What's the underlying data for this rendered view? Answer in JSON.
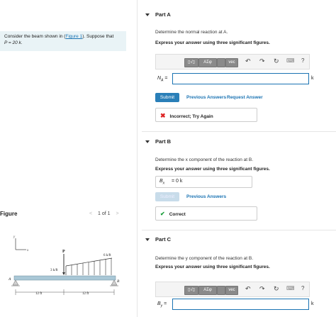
{
  "left": {
    "intro_prefix": "Consider the beam shown in (",
    "intro_link": "Figure 1",
    "intro_suffix": "). Suppose that",
    "intro_line2": "P = 20 k.",
    "figure_title": "Figure",
    "pager": "1 of 1",
    "prev_icon": "chevron-left-icon",
    "next_icon": "chevron-right-icon",
    "diagram": {
      "axis_y": "y",
      "axis_x": "x",
      "load_P": "P",
      "load_left": "3 k/ft",
      "load_right": "6 k/ft",
      "label_A": "A",
      "label_B": "B",
      "dim_left": "12 ft",
      "dim_right": "12 ft"
    }
  },
  "partA": {
    "title": "Part A",
    "question": "Determine the normal reaction at A.",
    "instruction": "Express your answer using three significant figures.",
    "label": "N",
    "sub": "A",
    "equals": "=",
    "unit": "k",
    "input_value": "",
    "submit": "Submit",
    "prev_answers": "Previous Answers",
    "request_answer": "Request Answer",
    "feedback": "Incorrect; Try Again"
  },
  "partB": {
    "title": "Part B",
    "question": "Determine the x component of the reaction at B.",
    "instruction": "Express your answer using three significant figures.",
    "label": "B",
    "sub": "x",
    "value_text": "= 0  k",
    "submit": "Submit",
    "prev_answers": "Previous Answers",
    "feedback": "Correct"
  },
  "partC": {
    "title": "Part C",
    "question": "Determine the y component of the reaction at B.",
    "instruction": "Express your answer using three significant figures.",
    "label": "B",
    "sub": "y",
    "equals": "=",
    "unit": "k",
    "input_value": ""
  },
  "toolbar": {
    "templates": "▯√▯",
    "greek": "ΑΣφ",
    "vec": "vec",
    "keyboard": "⌨",
    "help": "?"
  },
  "colors": {
    "accent": "#2a7fb8",
    "intro_bg": "#e9f3f6",
    "beam": "#a9c7d6",
    "load": "#333333"
  }
}
